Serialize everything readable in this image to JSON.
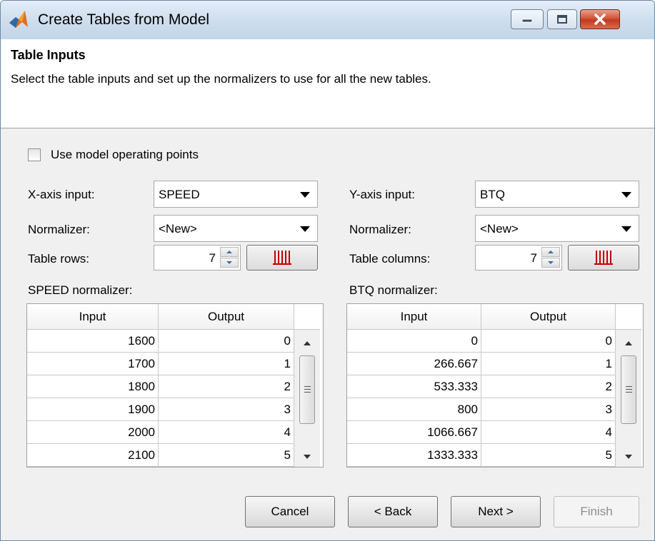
{
  "window": {
    "title": "Create Tables from Model",
    "controls": [
      "minimize-icon",
      "maximize-icon",
      "close-icon"
    ]
  },
  "header": {
    "title": "Table Inputs",
    "description": "Select the table inputs and set up the normalizers to use for all the new tables."
  },
  "options": {
    "use_operating_points_label": "Use model operating points",
    "use_operating_points_checked": false
  },
  "x_axis": {
    "input_label": "X-axis input:",
    "input_value": "SPEED",
    "normalizer_label": "Normalizer:",
    "normalizer_value": "<New>",
    "count_label": "Table rows:",
    "count_value": "7",
    "normalizer_title": "SPEED normalizer:",
    "columns": [
      "Input",
      "Output"
    ],
    "rows": [
      [
        "1600",
        "0"
      ],
      [
        "1700",
        "1"
      ],
      [
        "1800",
        "2"
      ],
      [
        "1900",
        "3"
      ],
      [
        "2000",
        "4"
      ],
      [
        "2100",
        "5"
      ]
    ]
  },
  "y_axis": {
    "input_label": "Y-axis input:",
    "input_value": "BTQ",
    "normalizer_label": "Normalizer:",
    "normalizer_value": "<New>",
    "count_label": "Table columns:",
    "count_value": "7",
    "normalizer_title": "BTQ normalizer:",
    "columns": [
      "Input",
      "Output"
    ],
    "rows": [
      [
        "0",
        "0"
      ],
      [
        "266.667",
        "1"
      ],
      [
        "533.333",
        "2"
      ],
      [
        "800",
        "3"
      ],
      [
        "1066.667",
        "4"
      ],
      [
        "1333.333",
        "5"
      ]
    ]
  },
  "buttons": {
    "cancel": "Cancel",
    "back": "< Back",
    "next": "Next >",
    "finish": "Finish",
    "finish_enabled": false
  },
  "colors": {
    "window_bg": "#f0f0f0",
    "header_bg": "#ffffff",
    "disabled_text": "#8d8d8d",
    "distribution_icon": "#c00000"
  }
}
